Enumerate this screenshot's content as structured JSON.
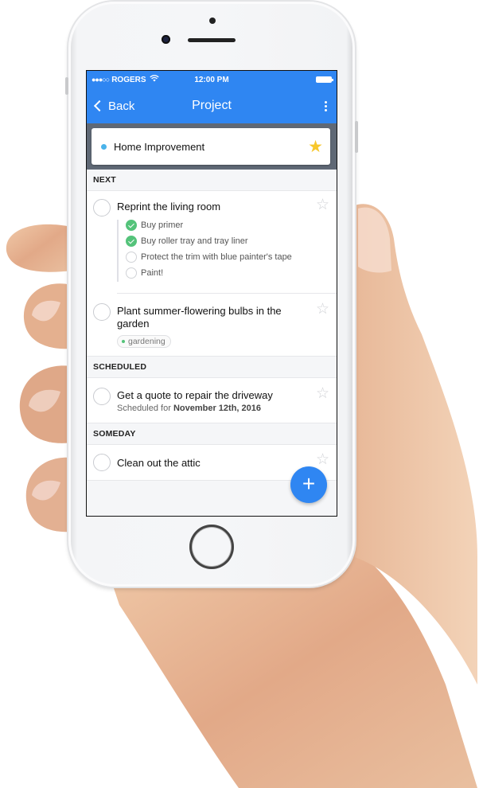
{
  "status_bar": {
    "signal": "●●●○○",
    "carrier": "ROGERS",
    "wifi_icon": "wifi-icon",
    "time": "12:00 PM",
    "battery_icon": "battery-full-icon"
  },
  "nav": {
    "back_label": "Back",
    "title": "Project",
    "more_icon": "more-vertical-icon"
  },
  "project": {
    "name": "Home Improvement",
    "dot_color": "#4ab3ea",
    "starred": true
  },
  "sections": {
    "next": {
      "label": "NEXT",
      "tasks": [
        {
          "title": "Reprint the living room",
          "starred": false,
          "checklist": [
            {
              "label": "Buy primer",
              "done": true
            },
            {
              "label": "Buy roller tray and tray liner",
              "done": true
            },
            {
              "label": "Protect the trim with blue painter's tape",
              "done": false
            },
            {
              "label": "Paint!",
              "done": false
            }
          ]
        },
        {
          "title": "Plant summer-flowering bulbs in the garden",
          "starred": false,
          "tag": "gardening"
        }
      ]
    },
    "scheduled": {
      "label": "SCHEDULED",
      "tasks": [
        {
          "title": "Get a quote to repair the driveway",
          "starred": false,
          "schedule_prefix": "Scheduled for",
          "schedule_date": "November 12th, 2016"
        }
      ]
    },
    "someday": {
      "label": "SOMEDAY",
      "tasks": [
        {
          "title": "Clean out the attic",
          "starred": false
        }
      ]
    }
  },
  "fab": {
    "label": "+",
    "icon": "plus-icon"
  },
  "colors": {
    "accent": "#2f86f2",
    "project_bar": "#5f6875",
    "star_filled": "#f7c72c",
    "check_done": "#54c37a",
    "tag_dot": "#54c37a"
  },
  "icons": {
    "star_filled": "★",
    "star_empty": "☆",
    "wifi": "📶"
  }
}
